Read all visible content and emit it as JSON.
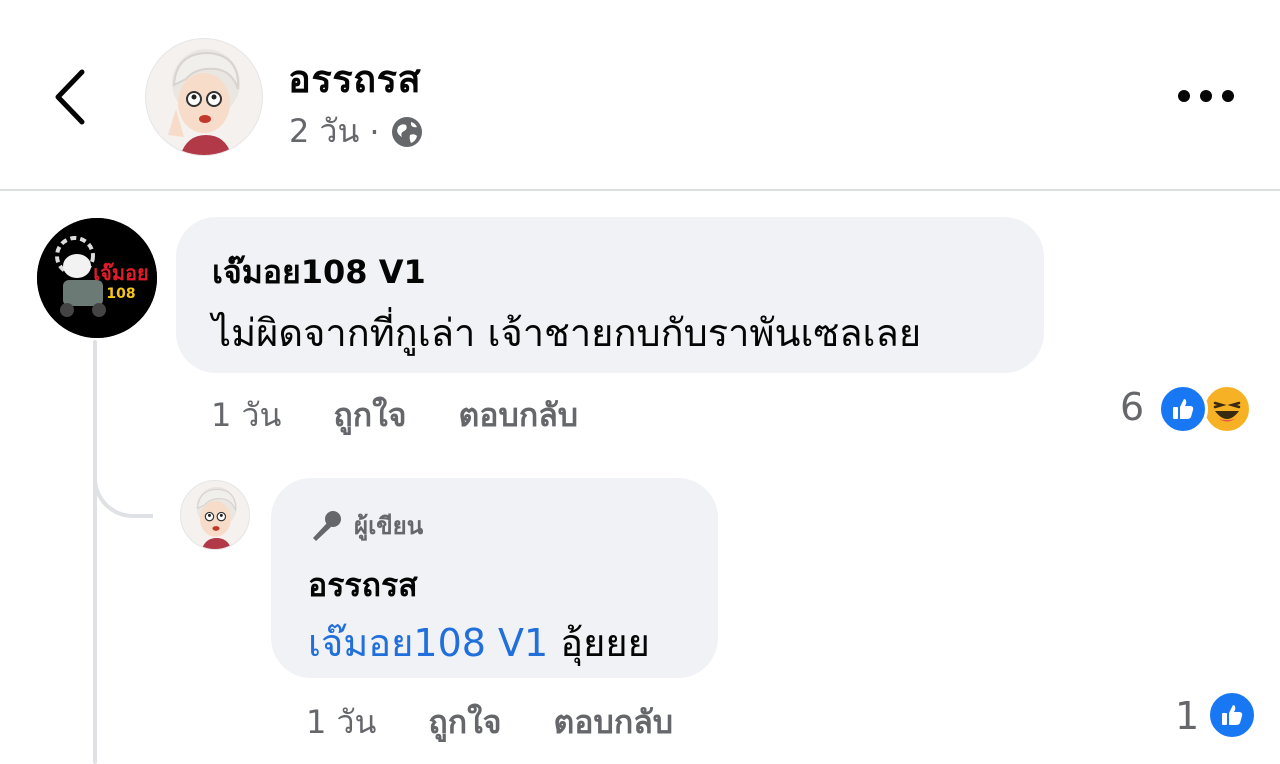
{
  "post_header": {
    "author_name": "อรรถรส",
    "time": "2 วัน",
    "separator": "·",
    "privacy_icon": "globe-icon",
    "back_icon": "chevron-left-icon",
    "more_icon": "more-horizontal-icon"
  },
  "comments": [
    {
      "author": "เจ๊มอย108 V1",
      "text": "ไม่ผิดจากที่กูเล่า เจ้าชายกบกับราพันเซลเลย",
      "time": "1 วัน",
      "like_label": "ถูกใจ",
      "reply_label": "ตอบกลับ",
      "reaction_count": "6",
      "reactions": [
        "like",
        "haha"
      ],
      "avatar_text": "เจ๊มอย",
      "avatar_sub": "108",
      "replies": [
        {
          "badge": "ผู้เขียน",
          "badge_icon": "microphone-icon",
          "author": "อรรถรส",
          "mention": "เจ๊มอย108 V1",
          "text": " อุ้ยยย",
          "time": "1 วัน",
          "like_label": "ถูกใจ",
          "reply_label": "ตอบกลับ",
          "reaction_count": "1",
          "reactions": [
            "like"
          ]
        }
      ]
    }
  ],
  "colors": {
    "bubble": "#f0f2f5",
    "secondary_text": "#65676b",
    "mention": "#216fdb",
    "like_blue": "#1877f2",
    "haha_yellow": "#f7b125"
  }
}
